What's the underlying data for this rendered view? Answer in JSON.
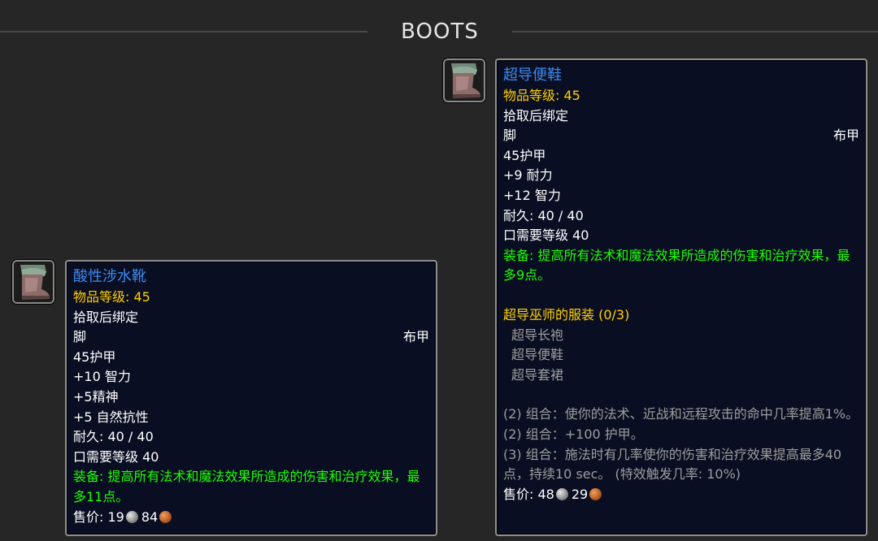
{
  "header": {
    "title": "BOOTS"
  },
  "items": [
    {
      "icon": "cloth-boots-icon",
      "name": "酸性涉水靴",
      "item_level": "物品等级: 45",
      "bind": "拾取后绑定",
      "slot": "脚",
      "armor_type": "布甲",
      "armor": "45护甲",
      "stats": [
        "+10 智力",
        "+5精神",
        "+5 自然抗性"
      ],
      "durability": "耐久: 40 / 40",
      "requires_level": "口需要等级 40",
      "equip": "装备:  提高所有法术和魔法效果所造成的伤害和治疗效果，最多11点。",
      "sell_label": "售价: ",
      "sell_silver": "19",
      "sell_copper": "84"
    },
    {
      "icon": "cloth-boots-icon",
      "name": "超导便鞋",
      "item_level": "物品等级: 45",
      "bind": "拾取后绑定",
      "slot": "脚",
      "armor_type": "布甲",
      "armor": "45护甲",
      "stats": [
        "+9 耐力",
        "+12 智力"
      ],
      "durability": "耐久: 40 / 40",
      "requires_level": "口需要等级 40",
      "equip": "装备:  提高所有法术和魔法效果所造成的伤害和治疗效果，最多9点。",
      "set_name": "超导巫师的服装 (0/3)",
      "set_pieces": [
        "超导长袍",
        "超导便鞋",
        "超导套裙"
      ],
      "set_bonuses": [
        "(2) 组合：使你的法术、近战和远程攻击的命中几率提高1%。",
        "(2) 组合：+100 护甲。",
        "(3) 组合：施法时有几率使你的伤害和治疗效果提高最多40点，持续10 sec。 (特效触发几率: 10%)"
      ],
      "sell_label": "售价: ",
      "sell_silver": "48",
      "sell_copper": "29"
    }
  ]
}
